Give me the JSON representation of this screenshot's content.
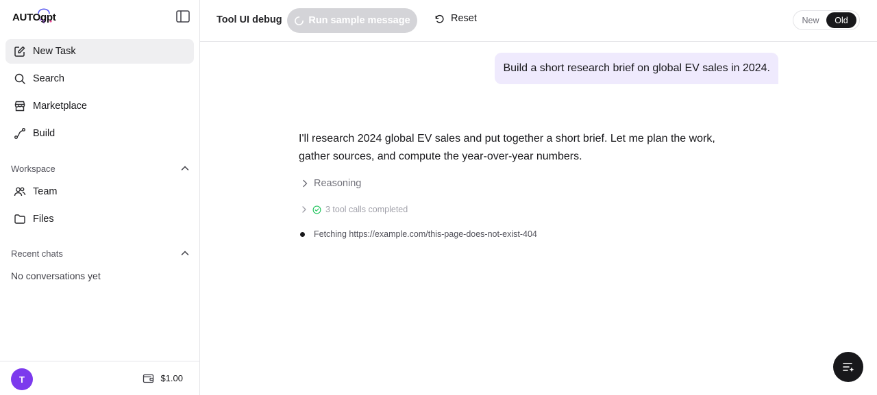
{
  "app": {
    "logo_text": "AUTOgpt"
  },
  "sidebar": {
    "nav": [
      {
        "label": "New Task",
        "icon": "edit-icon"
      },
      {
        "label": "Search",
        "icon": "search-icon"
      },
      {
        "label": "Marketplace",
        "icon": "store-icon"
      },
      {
        "label": "Build",
        "icon": "flow-icon"
      }
    ],
    "workspace": {
      "title": "Workspace",
      "items": [
        {
          "label": "Team",
          "icon": "users-icon"
        },
        {
          "label": "Files",
          "icon": "folder-icon"
        }
      ]
    },
    "recent": {
      "title": "Recent chats",
      "empty": "No conversations yet"
    },
    "footer": {
      "avatar_initial": "T",
      "avatar_color": "#7c3aed",
      "credits": "$1.00"
    }
  },
  "header": {
    "title": "Tool UI debug",
    "run_label": "Run sample message",
    "reset_label": "Reset",
    "toggle": {
      "new_label": "New",
      "old_label": "Old",
      "selected": "Old"
    }
  },
  "chat": {
    "user_message": "Build a short research brief on global EV sales in 2024.",
    "assistant_message": "I'll research 2024 global EV sales and put together a short brief. Let me plan the work, gather sources, and compute the year-over-year numbers.",
    "reasoning_label": "Reasoning",
    "tool_calls_label": "3 tool calls completed",
    "fetching_label": "Fetching https://example.com/this-page-does-not-exist-404"
  },
  "colors": {
    "accent": "#18181b",
    "user_bubble": "#efeafd",
    "success": "#22c55e"
  }
}
